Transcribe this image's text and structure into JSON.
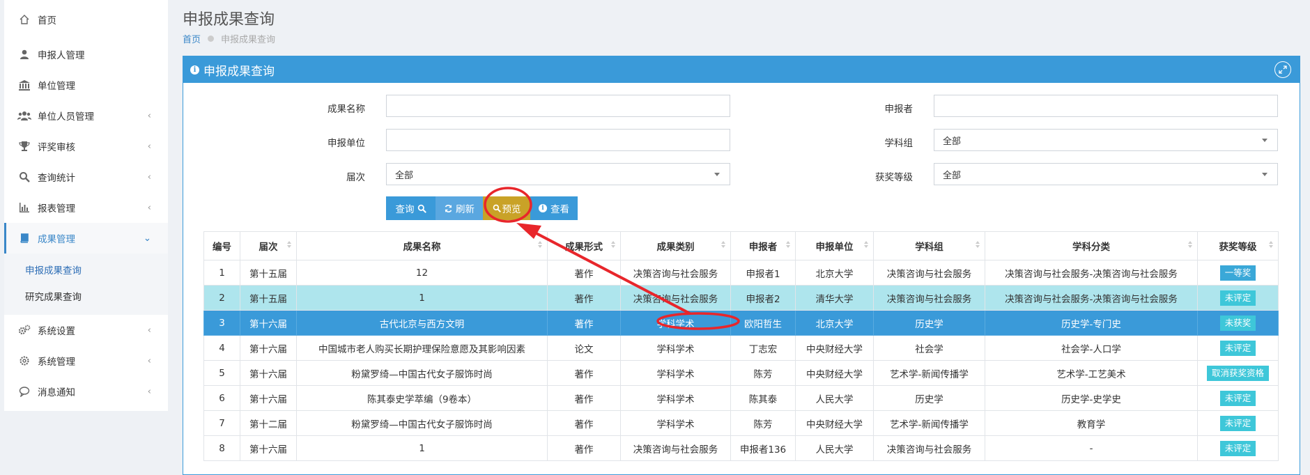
{
  "sidebar": {
    "items": [
      {
        "label": "首页",
        "icon": "home-icon"
      },
      {
        "label": "申报人管理",
        "icon": "user-icon"
      },
      {
        "label": "单位管理",
        "icon": "bank-icon"
      },
      {
        "label": "单位人员管理",
        "icon": "users-icon"
      },
      {
        "label": "评奖审核",
        "icon": "trophy-icon"
      },
      {
        "label": "查询统计",
        "icon": "search-icon"
      },
      {
        "label": "报表管理",
        "icon": "bar-chart-icon"
      },
      {
        "label": "成果管理",
        "icon": "book-icon"
      },
      {
        "label": "系统设置",
        "icon": "gears-icon"
      },
      {
        "label": "系统管理",
        "icon": "gear-icon"
      },
      {
        "label": "消息通知",
        "icon": "comment-icon"
      }
    ],
    "subitems": [
      {
        "label": "申报成果查询"
      },
      {
        "label": "研究成果查询"
      }
    ]
  },
  "page": {
    "title": "申报成果查询",
    "breadcrumb_home": "首页",
    "breadcrumb_current": "申报成果查询"
  },
  "panel": {
    "title": "申报成果查询"
  },
  "form": {
    "name_label": "成果名称",
    "name_value": "",
    "applicant_label": "申报者",
    "applicant_value": "",
    "unit_label": "申报单位",
    "unit_value": "",
    "group_label": "学科组",
    "group_value": "全部",
    "session_label": "届次",
    "session_value": "全部",
    "level_label": "获奖等级",
    "level_value": "全部"
  },
  "buttons": {
    "query": "查询",
    "refresh": "刷新",
    "preview": "预览",
    "view": "查看"
  },
  "table": {
    "headers": [
      "编号",
      "届次",
      "成果名称",
      "成果形式",
      "成果类别",
      "申报者",
      "申报单位",
      "学科组",
      "学科分类",
      "获奖等级"
    ],
    "rows": [
      {
        "no": "1",
        "session": "第十五届",
        "name": "12",
        "form": "著作",
        "category": "决策咨询与社会服务",
        "applicant": "申报者1",
        "unit": "北京大学",
        "group": "决策咨询与社会服务",
        "subject": "决策咨询与社会服务-决策咨询与社会服务",
        "level": "一等奖"
      },
      {
        "no": "2",
        "session": "第十五届",
        "name": "1",
        "form": "著作",
        "category": "决策咨询与社会服务",
        "applicant": "申报者2",
        "unit": "清华大学",
        "group": "决策咨询与社会服务",
        "subject": "决策咨询与社会服务-决策咨询与社会服务",
        "level": "未评定"
      },
      {
        "no": "3",
        "session": "第十六届",
        "name": "古代北京与西方文明",
        "form": "著作",
        "category": "学科学术",
        "applicant": "欧阳哲生",
        "unit": "北京大学",
        "group": "历史学",
        "subject": "历史学-专门史",
        "level": "未获奖"
      },
      {
        "no": "4",
        "session": "第十六届",
        "name": "中国城市老人购买长期护理保险意愿及其影响因素",
        "form": "论文",
        "category": "学科学术",
        "applicant": "丁志宏",
        "unit": "中央财经大学",
        "group": "社会学",
        "subject": "社会学-人口学",
        "level": "未评定"
      },
      {
        "no": "5",
        "session": "第十六届",
        "name": "粉黛罗绮—中国古代女子服饰时尚",
        "form": "著作",
        "category": "学科学术",
        "applicant": "陈芳",
        "unit": "中央财经大学",
        "group": "艺术学-新闻传播学",
        "subject": "艺术学-工艺美术",
        "level": "取消获奖资格"
      },
      {
        "no": "6",
        "session": "第十六届",
        "name": "陈其泰史学萃编（9卷本）",
        "form": "著作",
        "category": "学科学术",
        "applicant": "陈其泰",
        "unit": "人民大学",
        "group": "历史学",
        "subject": "历史学-史学史",
        "level": "未评定"
      },
      {
        "no": "7",
        "session": "第十二届",
        "name": "粉黛罗绮—中国古代女子服饰时尚",
        "form": "著作",
        "category": "学科学术",
        "applicant": "陈芳",
        "unit": "中央财经大学",
        "group": "艺术学-新闻传播学",
        "subject": "教育学",
        "level": "未评定"
      },
      {
        "no": "8",
        "session": "第十六届",
        "name": "1",
        "form": "著作",
        "category": "决策咨询与社会服务",
        "applicant": "申报者136",
        "unit": "人民大学",
        "group": "决策咨询与社会服务",
        "subject": "-",
        "level": "未评定"
      }
    ]
  },
  "colors": {
    "accent": "#3a9ad9",
    "selected_row": "#3a9ad9",
    "highlight_row": "#aee5ed",
    "badge": "#3ec7d9",
    "preview_button": "#c9a227",
    "annotation": "#e8262b"
  }
}
